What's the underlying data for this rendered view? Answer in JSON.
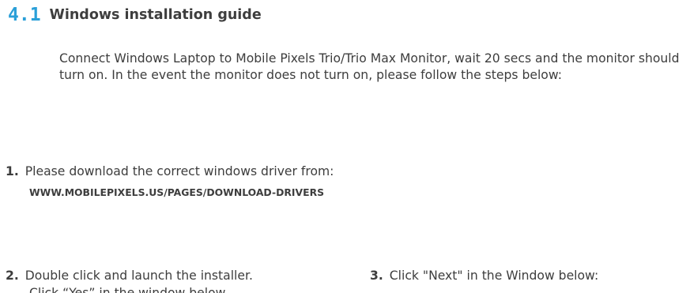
{
  "section": {
    "number": "4.1",
    "title": "Windows installation guide"
  },
  "intro": "Connect Windows Laptop to Mobile Pixels Trio/Trio Max Monitor, wait 20 secs and the monitor should turn on. In the event the monitor does not turn on, please follow the steps below:",
  "steps": [
    {
      "number": "1.",
      "text": "Please download the correct windows driver from:",
      "link": "WWW.MOBILEPIXELS.US/PAGES/DOWNLOAD-DRIVERS"
    },
    {
      "number": "2.",
      "text": "Double click and launch the installer.",
      "text_line2": "Click “Yes” in the window below."
    },
    {
      "number": "3.",
      "text": "Click \"Next\" in the Window below:"
    }
  ],
  "colors": {
    "accent": "#2a9fd8",
    "text": "#3d3d3d"
  }
}
